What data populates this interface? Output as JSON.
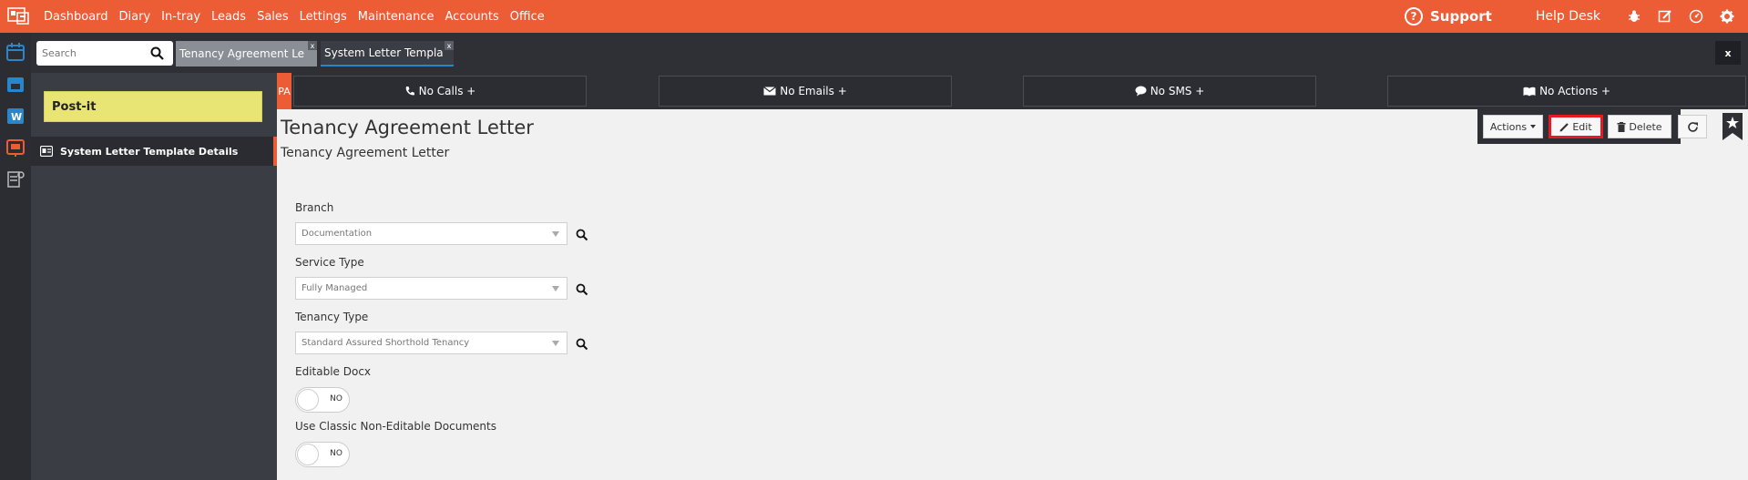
{
  "nav": {
    "items": [
      "Dashboard",
      "Diary",
      "In-tray",
      "Leads",
      "Sales",
      "Lettings",
      "Maintenance",
      "Accounts",
      "Office"
    ],
    "support_label": "Support",
    "help_desk_label": "Help Desk"
  },
  "tabs": {
    "search_placeholder": "Search",
    "items": [
      {
        "label": "Tenancy Agreement Le"
      },
      {
        "label": "System Letter Templa"
      }
    ],
    "close_glyph": "x"
  },
  "sidebar": {
    "postit_label": "Post-it",
    "item_label": "System Letter Template Details"
  },
  "commbar": {
    "pa_label": "PA",
    "calls": "No Calls  +",
    "emails": "No Emails  +",
    "sms": "No SMS  +",
    "actions": "No Actions  +"
  },
  "main": {
    "title": "Tenancy Agreement Letter",
    "subtitle": "Tenancy Agreement Letter",
    "buttons": {
      "actions": "Actions",
      "edit": "Edit",
      "delete": "Delete"
    },
    "fields": [
      {
        "label": "Branch",
        "value": "Documentation"
      },
      {
        "label": "Service Type",
        "value": "Fully Managed"
      },
      {
        "label": "Tenancy Type",
        "value": "Standard Assured Shorthold Tenancy"
      }
    ],
    "toggles": [
      {
        "label": "Editable Docx",
        "value": "NO"
      },
      {
        "label": "Use Classic Non-Editable Documents",
        "value": "NO"
      }
    ]
  },
  "colors": {
    "accent": "#ec5c35",
    "dark": "#2e3036",
    "highlight": "#e41b23"
  }
}
